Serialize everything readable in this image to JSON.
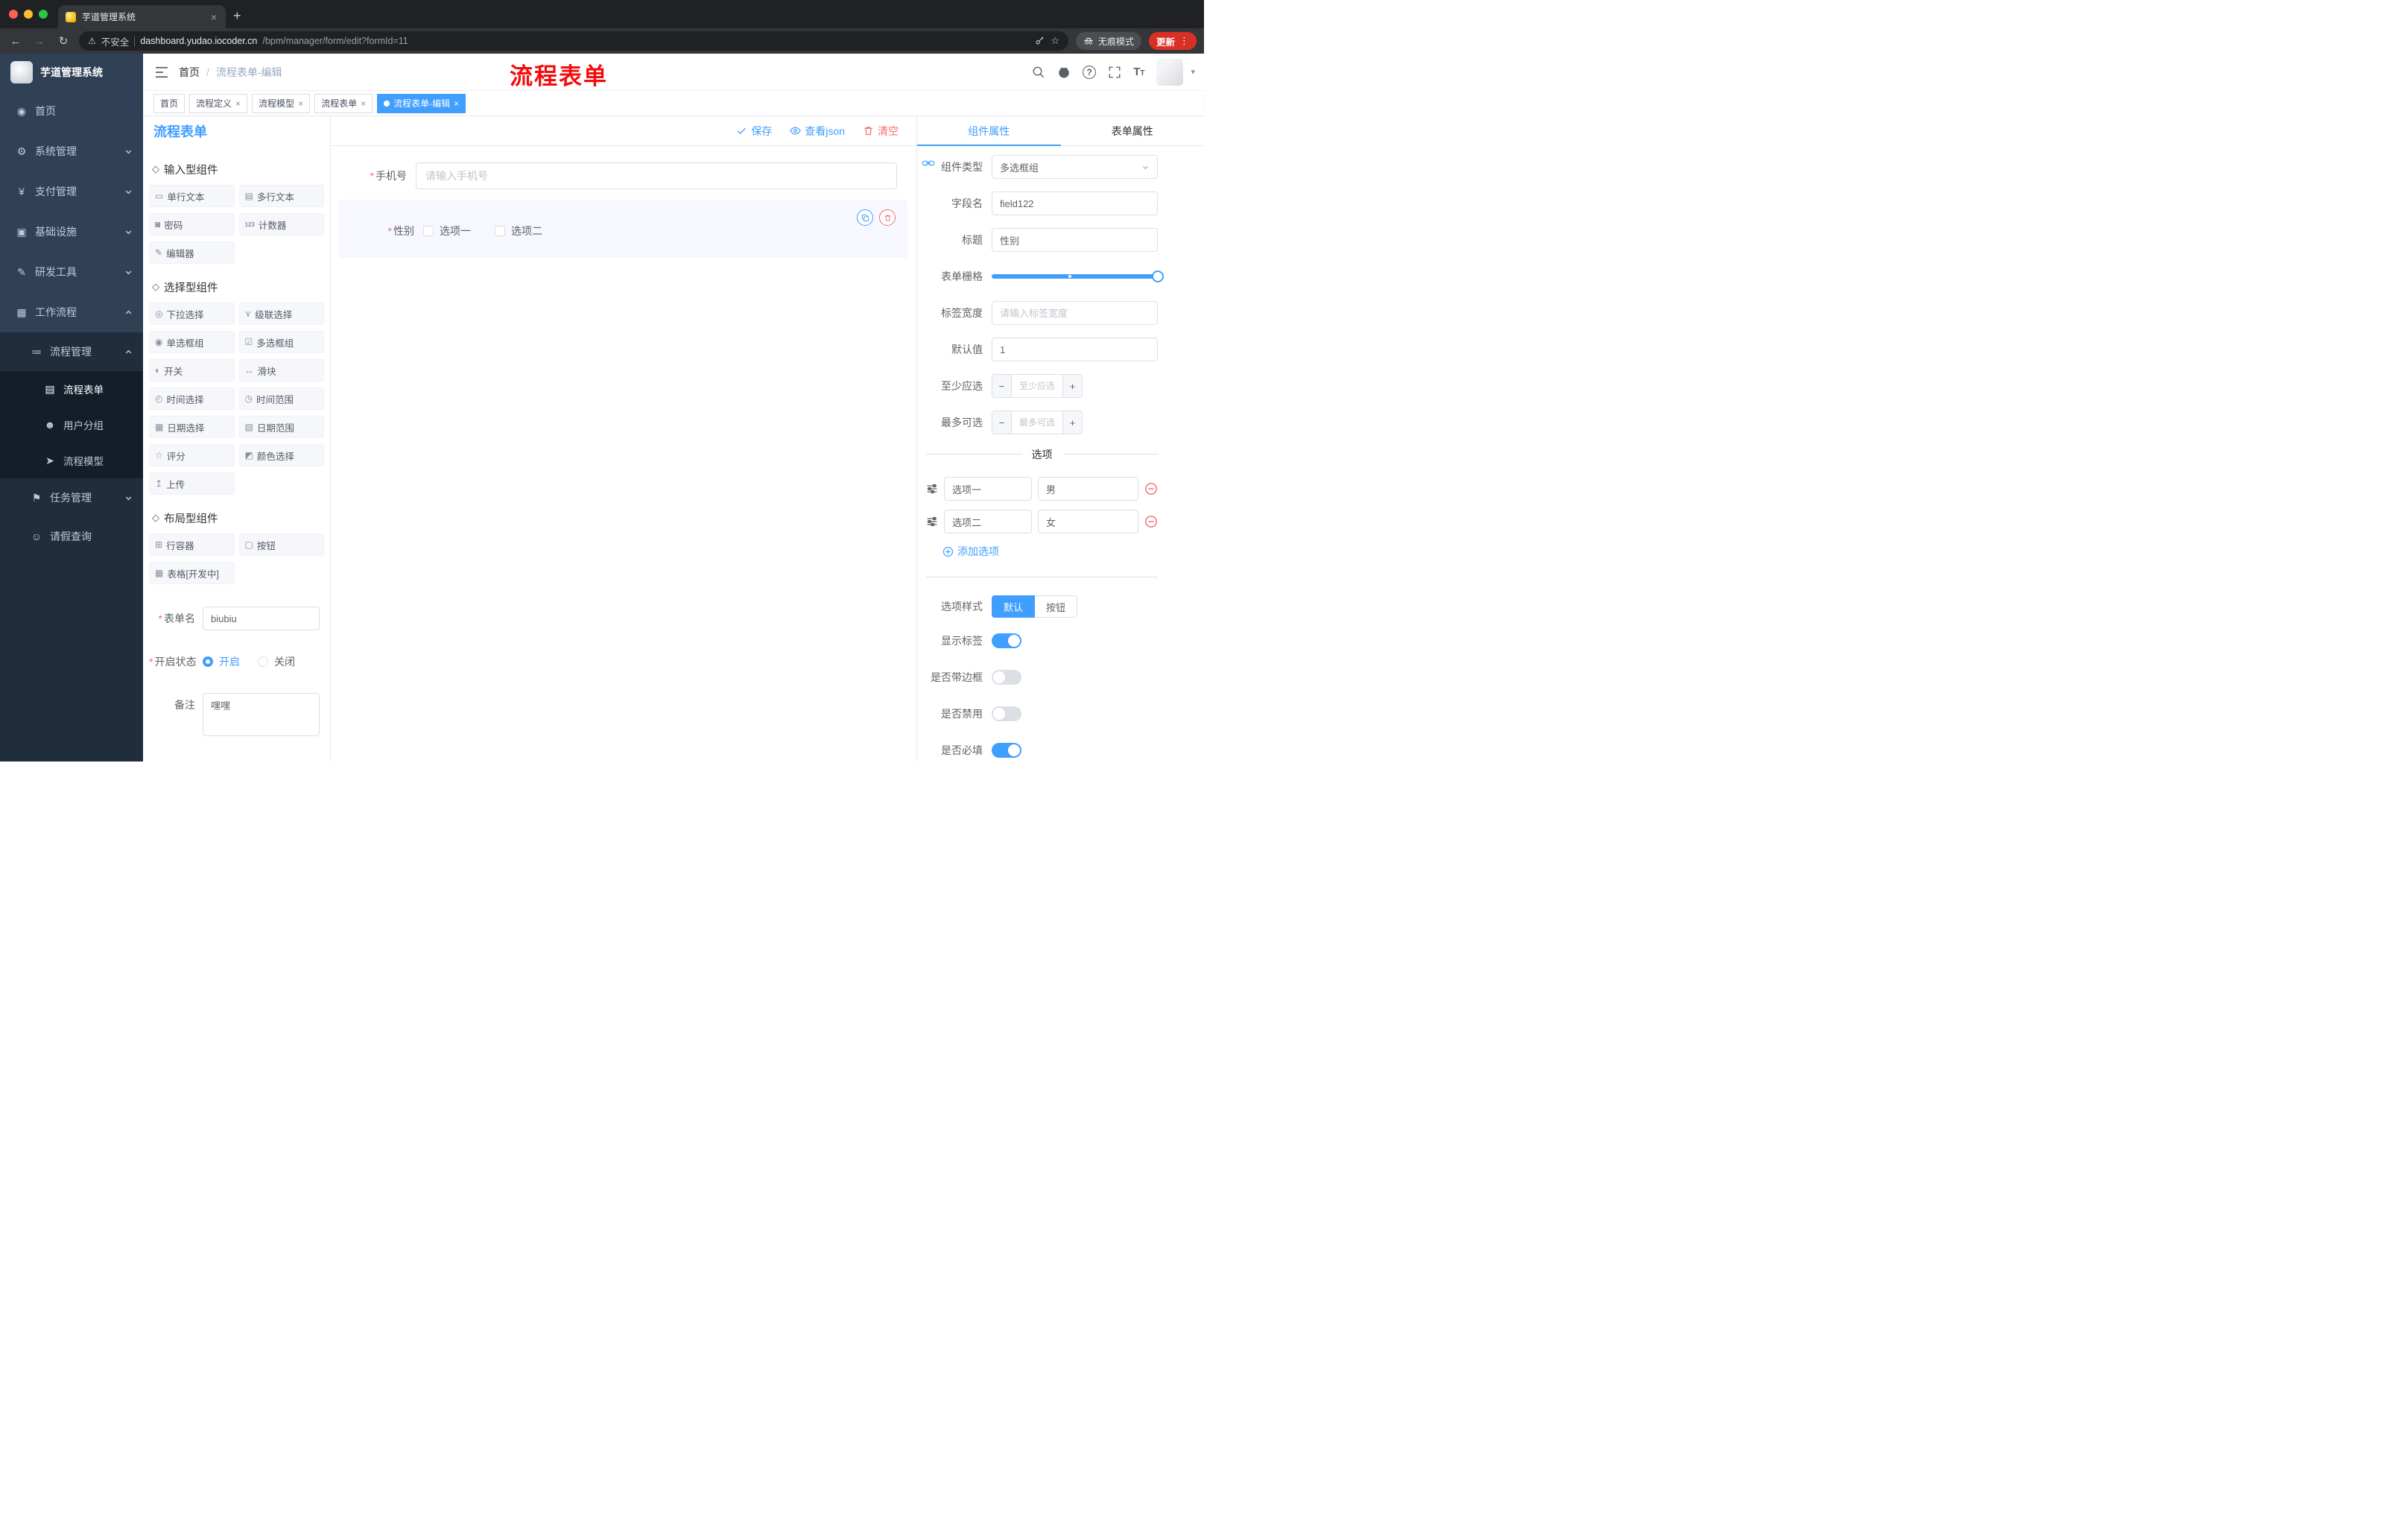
{
  "colors": {
    "accent": "#409eff",
    "danger": "#f56c6c",
    "annotation": "#f40b0b",
    "sidebar": "#304156"
  },
  "icons": {
    "back": "←",
    "forward": "→",
    "reload": "↻",
    "home": "⌂",
    "warning": "⚠",
    "star": "☆",
    "new_tab": "+",
    "close": "×",
    "dots": "⋮",
    "caret": "▾",
    "menu_home": "◉",
    "menu_system": "⚙",
    "menu_pay": "¥",
    "menu_infra": "▣",
    "menu_dev": "✎",
    "menu_flow": "▦",
    "menu_procmgr": "≔",
    "menu_form": "▤",
    "menu_group": "☻",
    "menu_model": "➤",
    "menu_task": "⚑",
    "menu_leave": "☺",
    "cube": "◇",
    "comp_input": "▭",
    "comp_textarea": "▤",
    "comp_password": "◙",
    "comp_counter": "123",
    "comp_editor": "✎",
    "comp_select": "◎",
    "comp_cascader": "⋎",
    "comp_radio": "◉",
    "comp_checkbox": "☑",
    "comp_switch": "◐",
    "comp_slider": "↔",
    "comp_time": "◴",
    "comp_timerange": "◷",
    "comp_date": "▦",
    "comp_daterange": "▧",
    "comp_rate": "☆",
    "comp_color": "◩",
    "comp_upload": "↥",
    "comp_row": "⊞",
    "comp_button": "▢",
    "comp_table": "▦"
  },
  "browser": {
    "tab_title": "芋道管理系统",
    "security_label": "不安全",
    "url_host": "dashboard.yudao.iocoder.cn",
    "url_path": "/bpm/manager/form/edit?formId=11",
    "incognito_label": "无痕模式",
    "update_label": "更新"
  },
  "sidebar": {
    "logo_title": "芋道管理系统",
    "items": [
      {
        "label": "首页"
      },
      {
        "label": "系统管理"
      },
      {
        "label": "支付管理"
      },
      {
        "label": "基础设施"
      },
      {
        "label": "研发工具"
      },
      {
        "label": "工作流程"
      },
      {
        "label": "流程管理"
      },
      {
        "label": "流程表单"
      },
      {
        "label": "用户分组"
      },
      {
        "label": "流程模型"
      },
      {
        "label": "任务管理"
      },
      {
        "label": "请假查询"
      }
    ]
  },
  "header": {
    "breadcrumb_home": "首页",
    "breadcrumb_separator": "/",
    "breadcrumb_current": "流程表单-编辑",
    "annotation": "流程表单"
  },
  "tags": [
    {
      "label": "首页"
    },
    {
      "label": "流程定义"
    },
    {
      "label": "流程模型"
    },
    {
      "label": "流程表单"
    },
    {
      "label": "流程表单-编辑"
    }
  ],
  "palette": {
    "title": "流程表单",
    "groups": [
      {
        "title": "输入型组件",
        "items": [
          {
            "label": "单行文本"
          },
          {
            "label": "多行文本"
          },
          {
            "label": "密码"
          },
          {
            "label": "计数器"
          },
          {
            "label": "编辑器"
          }
        ]
      },
      {
        "title": "选择型组件",
        "items": [
          {
            "label": "下拉选择"
          },
          {
            "label": "级联选择"
          },
          {
            "label": "单选框组"
          },
          {
            "label": "多选框组"
          },
          {
            "label": "开关"
          },
          {
            "label": "滑块"
          },
          {
            "label": "时间选择"
          },
          {
            "label": "时间范围"
          },
          {
            "label": "日期选择"
          },
          {
            "label": "日期范围"
          },
          {
            "label": "评分"
          },
          {
            "label": "颜色选择"
          },
          {
            "label": "上传"
          }
        ]
      },
      {
        "title": "布局型组件",
        "items": [
          {
            "label": "行容器"
          },
          {
            "label": "按钮"
          },
          {
            "label": "表格[开发中]"
          }
        ]
      }
    ],
    "form": {
      "name_label": "表单名",
      "name_value": "biubiu",
      "status_label": "开启状态",
      "status_on": "开启",
      "status_off": "关闭",
      "remark_label": "备注",
      "remark_value": "嘿嘿"
    }
  },
  "canvas": {
    "toolbar": {
      "save": "保存",
      "view_json": "查看json",
      "clear": "清空"
    },
    "phone": {
      "label": "手机号",
      "placeholder": "请输入手机号"
    },
    "gender": {
      "label": "性别",
      "option1": "选项一",
      "option2": "选项二"
    }
  },
  "props": {
    "tab_component": "组件属性",
    "tab_form": "表单属性",
    "component_type_label": "组件类型",
    "component_type_value": "多选框组",
    "field_name_label": "字段名",
    "field_name_value": "field122",
    "title_label": "标题",
    "title_value": "性别",
    "grid_label": "表单栅格",
    "label_width_label": "标签宽度",
    "label_width_placeholder": "请输入标签宽度",
    "default_label": "默认值",
    "default_value": "1",
    "min_label": "至少应选",
    "min_placeholder": "至少应选",
    "max_label": "最多可选",
    "max_placeholder": "最多可选",
    "minus": "−",
    "plus": "+",
    "options_title": "选项",
    "options": [
      {
        "label": "选项一",
        "value": "男"
      },
      {
        "label": "选项二",
        "value": "女"
      }
    ],
    "add_option": "添加选项",
    "style_label": "选项样式",
    "style_default": "默认",
    "style_button": "按钮",
    "switch_show_label": "显示标签",
    "switch_border": "是否带边框",
    "switch_disabled": "是否禁用",
    "switch_required": "是否必填"
  }
}
